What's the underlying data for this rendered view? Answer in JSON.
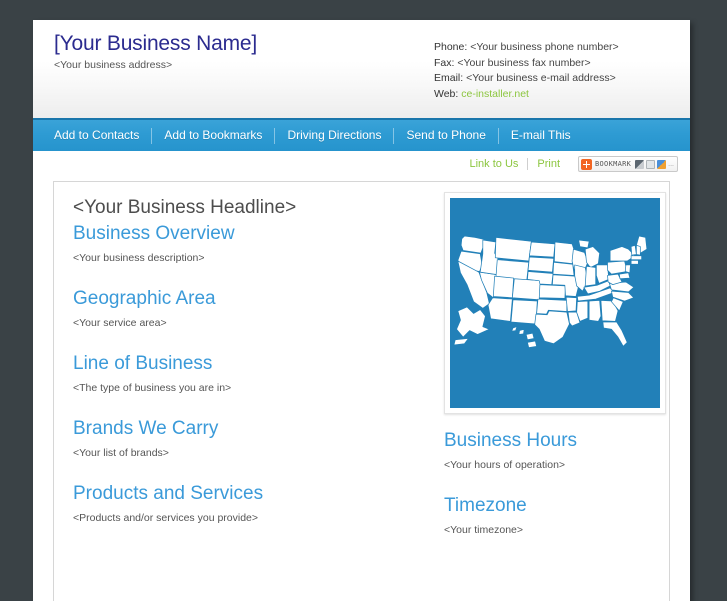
{
  "header": {
    "business_name": "[Your Business Name]",
    "business_address": "<Your business address>",
    "contact": {
      "phone_label": "Phone:",
      "phone_value": "<Your business phone number>",
      "fax_label": "Fax:",
      "fax_value": "<Your business fax number>",
      "email_label": "Email:",
      "email_value": "<Your business e-mail address>",
      "web_label": "Web:",
      "web_value": "ce-installer.net"
    }
  },
  "main_nav": {
    "items": [
      {
        "label": "Add to Contacts"
      },
      {
        "label": "Add to Bookmarks"
      },
      {
        "label": "Driving Directions"
      },
      {
        "label": "Send to Phone"
      },
      {
        "label": "E-mail This"
      }
    ]
  },
  "util_bar": {
    "link_to_us": "Link to Us",
    "print": "Print",
    "bookmark_widget": {
      "label": "BOOKMARK",
      "plus_icon_color": "#f26522",
      "more_dots": "..."
    }
  },
  "content": {
    "headline": "<Your Business Headline>",
    "left_sections": [
      {
        "title": "Business Overview",
        "body": "<Your business description>"
      },
      {
        "title": "Geographic Area",
        "body": "<Your service area>"
      },
      {
        "title": "Line of Business",
        "body": "<The type of business you are in>"
      },
      {
        "title": "Brands We Carry",
        "body": "<Your list of brands>"
      },
      {
        "title": "Products and Services",
        "body": "<Products and/or services you provide>"
      }
    ],
    "right_sections": [
      {
        "title": "Business Hours",
        "body": "<Your hours of operation>"
      },
      {
        "title": "Timezone",
        "body": "<Your timezone>"
      }
    ],
    "map": {
      "name": "united-states-map",
      "background_color": "#2280b8",
      "land_color": "#ffffff"
    }
  },
  "colors": {
    "page_background": "#3a4246",
    "nav_blue": "#2e9bd3",
    "heading_blue": "#3a9ad9",
    "link_green": "#8cc63f",
    "business_name_navy": "#2b2b8f"
  }
}
